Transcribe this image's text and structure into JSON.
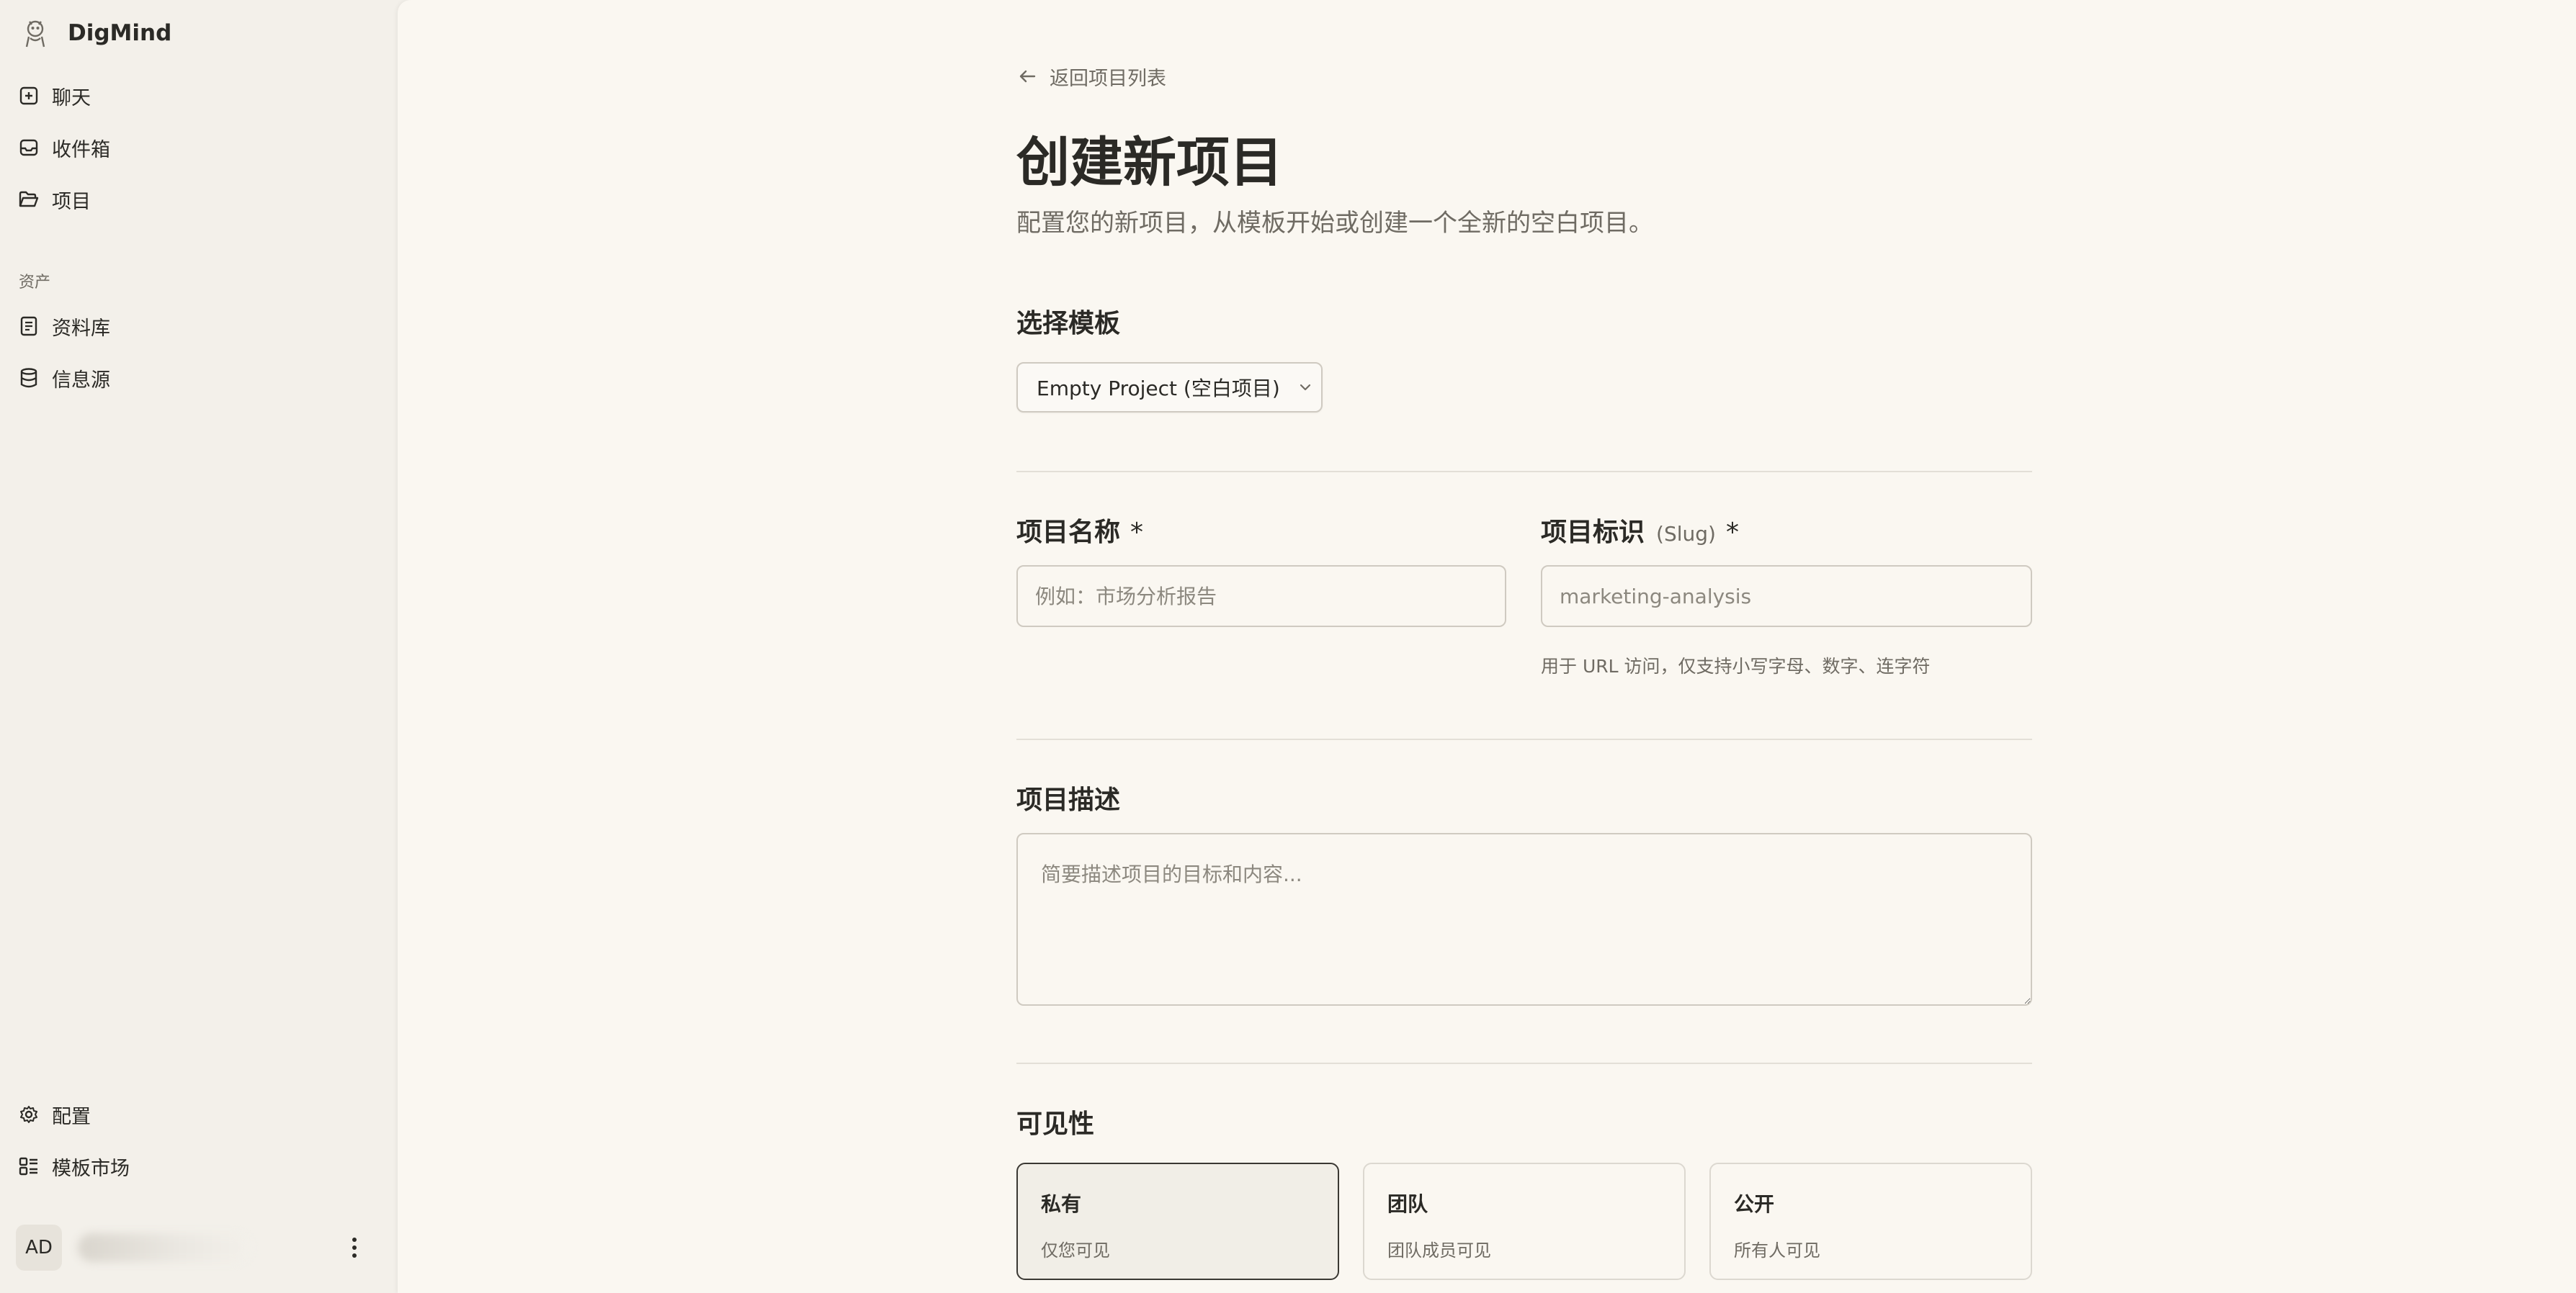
{
  "sidebar": {
    "brand": "DigMind",
    "nav": [
      {
        "label": "聊天",
        "icon": "plus-square-icon"
      },
      {
        "label": "收件箱",
        "icon": "inbox-icon"
      },
      {
        "label": "项目",
        "icon": "folder-open-icon"
      }
    ],
    "assets_section_label": "资产",
    "assets": [
      {
        "label": "资料库",
        "icon": "book-icon"
      },
      {
        "label": "信息源",
        "icon": "database-icon"
      }
    ],
    "bottom": [
      {
        "label": "配置",
        "icon": "gear-icon"
      },
      {
        "label": "模板市场",
        "icon": "template-grid-icon"
      }
    ],
    "user": {
      "initials": "AD"
    }
  },
  "main": {
    "back_label": "返回项目列表",
    "title": "创建新项目",
    "subtitle": "配置您的新项目，从模板开始或创建一个全新的空白项目。",
    "template_section": "选择模板",
    "template_value": "Empty Project (空白项目)",
    "name_label": "项目名称",
    "name_required": "*",
    "name_placeholder": "例如：市场分析报告",
    "slug_label": "项目标识",
    "slug_hint": "(Slug)",
    "slug_required": "*",
    "slug_placeholder": "marketing-analysis",
    "slug_helper": "用于 URL 访问，仅支持小写字母、数字、连字符",
    "description_label": "项目描述",
    "description_placeholder": "简要描述项目的目标和内容...",
    "visibility_label": "可见性",
    "visibility_options": [
      {
        "title": "私有",
        "desc": "仅您可见",
        "selected": true
      },
      {
        "title": "团队",
        "desc": "团队成员可见",
        "selected": false
      },
      {
        "title": "公开",
        "desc": "所有人可见",
        "selected": false
      }
    ]
  }
}
